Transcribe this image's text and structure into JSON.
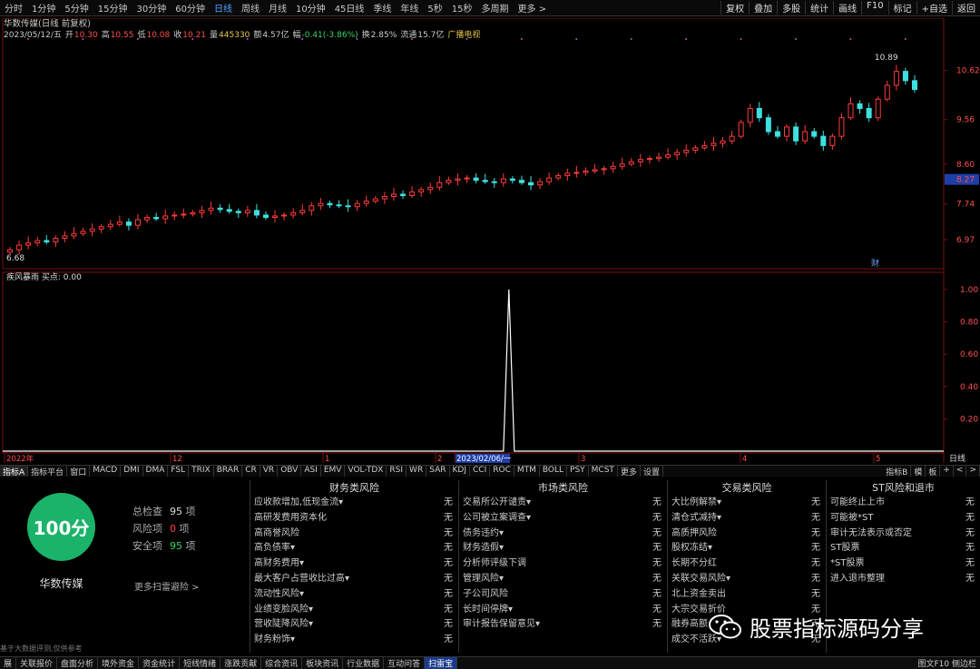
{
  "periods": [
    "分时",
    "1分钟",
    "5分钟",
    "15分钟",
    "30分钟",
    "60分钟",
    "日线",
    "周线",
    "月线",
    "10分钟",
    "45日线",
    "季线",
    "年线",
    "5秒",
    "15秒",
    "多周期",
    "更多 >"
  ],
  "active_period": "日线",
  "right_tools": [
    "复权",
    "叠加",
    "多股",
    "统计",
    "画线",
    "F10",
    "标记",
    "+自选",
    "返回"
  ],
  "title_line": "华数传媒(日线 前复权)",
  "quote": {
    "date": "2023/05/12/五",
    "open_label": "开",
    "open": "10.30",
    "high_label": "高",
    "high": "10.55",
    "low_label": "低",
    "low": "10.08",
    "close_label": "收",
    "close": "10.21",
    "vol_label": "量",
    "vol": "445330",
    "amt_label": "额",
    "amt": "4.57亿",
    "chg_label": "幅",
    "chg": "-0.41(-3.86%)",
    "turn_label": "换",
    "turn": "2.85%",
    "float_label": "流通",
    "float": "15.7亿",
    "industry": "广播电视"
  },
  "price_axis": [
    "10.62",
    "9.56",
    "8.60",
    "8.27",
    "7.74",
    "6.97"
  ],
  "price_marks": {
    "hi": "10.89",
    "lo": "6.68",
    "current": "8.27"
  },
  "indicator_title": "疾风暴雨 买点: 0.00",
  "ind_axis": [
    "1.00",
    "0.80",
    "0.60",
    "0.40",
    "0.20"
  ],
  "date_axis": [
    "2022年",
    "12",
    "1",
    "2",
    "2023/02/06/一",
    "3",
    "4",
    "5"
  ],
  "date_axis_right": "日线",
  "cai": "财",
  "chart_data": {
    "type": "line",
    "ylim": [
      6.5,
      11.2
    ],
    "candles": [
      6.75,
      6.85,
      6.9,
      6.95,
      6.92,
      7.0,
      7.05,
      7.1,
      7.15,
      7.2,
      7.25,
      7.3,
      7.35,
      7.28,
      7.4,
      7.45,
      7.42,
      7.48,
      7.5,
      7.52,
      7.55,
      7.6,
      7.65,
      7.62,
      7.58,
      7.55,
      7.6,
      7.5,
      7.45,
      7.48,
      7.5,
      7.55,
      7.6,
      7.7,
      7.75,
      7.72,
      7.7,
      7.68,
      7.75,
      7.8,
      7.85,
      7.9,
      7.95,
      7.92,
      8.0,
      8.05,
      8.1,
      8.2,
      8.25,
      8.28,
      8.3,
      8.25,
      8.22,
      8.2,
      8.28,
      8.25,
      8.2,
      8.15,
      8.22,
      8.3,
      8.35,
      8.4,
      8.42,
      8.45,
      8.48,
      8.5,
      8.55,
      8.6,
      8.65,
      8.7,
      8.72,
      8.75,
      8.8,
      8.85,
      8.9,
      8.95,
      9.0,
      9.05,
      9.1,
      9.2,
      9.5,
      9.8,
      9.6,
      9.3,
      9.2,
      9.4,
      9.1,
      9.3,
      9.2,
      9.0,
      9.2,
      9.6,
      9.9,
      9.8,
      9.6,
      10.0,
      10.3,
      10.6,
      10.4,
      10.21
    ],
    "signal": {
      "index": 54,
      "value": 1.0
    },
    "ind_ylim": [
      0,
      1.05
    ]
  },
  "tabs": [
    "指标A",
    "指标平台",
    "窗口",
    "MACD",
    "DMI",
    "DMA",
    "FSL",
    "TRIX",
    "BRAR",
    "CR",
    "VR",
    "OBV",
    "ASI",
    "EMV",
    "VOL-TDX",
    "RSI",
    "WR",
    "SAR",
    "KDJ",
    "CCI",
    "ROC",
    "MTM",
    "BOLL",
    "PSY",
    "MCST",
    "更多",
    "设置"
  ],
  "tabs_right": [
    "指标B",
    "模",
    "板",
    "+",
    "<",
    ">"
  ],
  "risk": {
    "score": "100分",
    "name": "华数传媒",
    "total_label": "总检查",
    "total": "95",
    "total_unit": "项",
    "risk_label": "风险项",
    "risk": "0",
    "risk_unit": "项",
    "safe_label": "安全项",
    "safe": "95",
    "safe_unit": "项",
    "more": "更多扫雷避险 >",
    "disclaimer": "基于大数据评测,仅供参考"
  },
  "columns": [
    {
      "title": "财务类风险",
      "rows": [
        "应收款增加,低现金流▾",
        "高研发费用资本化",
        "高商誉风险",
        "高负债率▾",
        "高财务费用▾",
        "最大客户占营收比过高▾",
        "流动性风险▾",
        "业绩变脸风险▾",
        "营收陡降风险▾",
        "财务粉饰▾"
      ]
    },
    {
      "title": "市场类风险",
      "rows": [
        "交易所公开谴责▾",
        "公司被立案调查▾",
        "债务违约▾",
        "财务造假▾",
        "分析师评级下调",
        "管理风险▾",
        "子公司风险",
        "长时间停牌▾",
        "审计报告保留意见▾"
      ]
    },
    {
      "title": "交易类风险",
      "rows": [
        "大比例解禁▾",
        "清仓式减持▾",
        "高质押风险",
        "股权冻结▾",
        "长期不分红",
        "关联交易风险▾",
        "北上资金卖出",
        "大宗交易折价",
        "融券高额",
        "成交不活跃▾"
      ]
    },
    {
      "title": "ST风险和退市",
      "rows": [
        "可能终止上市",
        "可能被*ST",
        "审计无法表示或否定",
        "ST股票",
        "*ST股票",
        "进入退市整理"
      ]
    }
  ],
  "none": "无",
  "footer": [
    "展",
    "关联报价",
    "盘面分析",
    "境外资金",
    "资金统计",
    "短线情绪",
    "涨跌贡献",
    "综合资讯",
    "板块资讯",
    "行业数据",
    "互动问答",
    "扫雷宝"
  ],
  "footer_active": "扫雷宝",
  "footer_right": "图文F10 侧边栏",
  "watermark": "股票指标源码分享"
}
